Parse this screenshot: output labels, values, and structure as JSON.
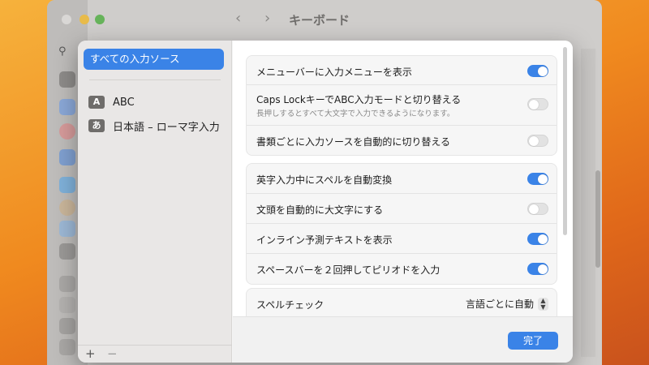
{
  "background_window": {
    "title": "キーボード",
    "back_icon": "chevron-left-icon",
    "forward_icon": "chevron-right-icon",
    "search_icon": "search-icon"
  },
  "sidebar": {
    "selected_label": "すべての入力ソース",
    "items": [
      {
        "badge": "A",
        "label": "ABC"
      },
      {
        "badge": "あ",
        "label": "日本語 – ローマ字入力"
      }
    ],
    "add_label": "+",
    "remove_label": "−"
  },
  "settings": {
    "group1": [
      {
        "label": "メニューバーに入力メニューを表示",
        "toggle": true
      },
      {
        "label": "Caps LockキーでABC入力モードと切り替える",
        "subtitle": "長押しするとすべて大文字で入力できるようになります。",
        "toggle": false
      },
      {
        "label": "書類ごとに入力ソースを自動的に切り替える",
        "toggle": false
      }
    ],
    "group2": [
      {
        "label": "英字入力中にスペルを自動変換",
        "toggle": true
      },
      {
        "label": "文頭を自動的に大文字にする",
        "toggle": false
      },
      {
        "label": "インライン予測テキストを表示",
        "toggle": true
      },
      {
        "label": "スペースバーを２回押してピリオドを入力",
        "toggle": true
      }
    ],
    "spell_check": {
      "label": "スペルチェック",
      "value": "言語ごとに自動"
    }
  },
  "footer": {
    "done_label": "完了"
  },
  "colors": {
    "accent": "#3a83e7",
    "toggle_off": "#e2e2e2"
  }
}
